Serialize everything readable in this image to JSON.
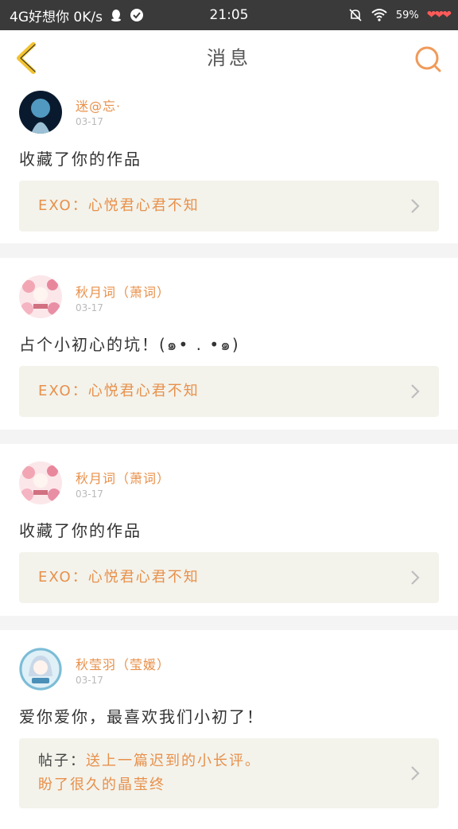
{
  "status_bar": {
    "network": "4G好想你 0K/s",
    "time": "21:05",
    "battery": "59%"
  },
  "header": {
    "title": "消息"
  },
  "notifications": [
    {
      "user": "迷@忘·",
      "date": "03-17",
      "message": "收藏了你的作品",
      "work_title": "EXO：心悦君心君不知"
    },
    {
      "user": "秋月词（萧词）",
      "date": "03-17",
      "message": "占个小初心的坑！(๑• . •๑)",
      "work_title": "EXO：心悦君心君不知"
    },
    {
      "user": "秋月词（萧词）",
      "date": "03-17",
      "message": "收藏了你的作品",
      "work_title": "EXO：心悦君心君不知"
    },
    {
      "user": "秋莹羽（莹媛）",
      "date": "03-17",
      "message": "爱你爱你，最喜欢我们小初了！",
      "post_prefix": "帖子：",
      "post_line1": "送上一篇迟到的小长评。",
      "post_line2": "盼了很久的晶莹终"
    }
  ],
  "colors": {
    "accent": "#e8904a",
    "back_arrow": "#f2c230",
    "status_bar": "#3a3a3a",
    "work_bg": "#f3f3ec"
  }
}
